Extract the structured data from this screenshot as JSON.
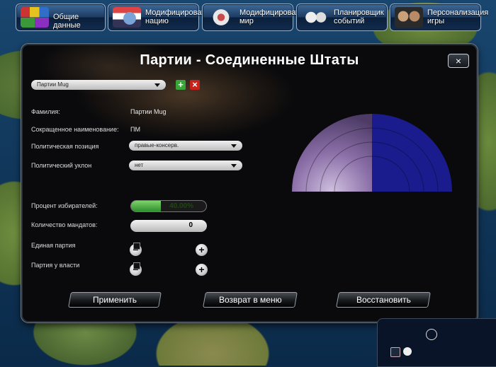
{
  "tabs": [
    {
      "label": "Общие данные",
      "icon": "bricks-icon"
    },
    {
      "label": "Модифицировать нацию",
      "icon": "flag-globe-icon"
    },
    {
      "label": "Модифицировать мир",
      "icon": "world-tools-icon"
    },
    {
      "label": "Планировщик событий",
      "icon": "events-icon"
    },
    {
      "label": "Персонализация игры",
      "icon": "leaders-icon"
    }
  ],
  "dialog": {
    "title": "Партии  -  Соединенные Штаты",
    "close_label": "×",
    "party_select": "Партии Mug",
    "add_label": "+",
    "delete_label": "×",
    "fields": {
      "family_label": "Фамилия:",
      "family_value": "Партии Mug",
      "short_label": "Сокращенное наименование:",
      "short_value": "ПМ",
      "position_label": "Политическая позиция",
      "position_value": "правые-консерв.",
      "bias_label": "Политический уклон",
      "bias_value": "нет",
      "voters_label": "Процент избирателей:",
      "voters_value": "40.00%",
      "voters_fraction": 0.4,
      "seats_label": "Количество мандатов:",
      "seats_value": "0",
      "single_label": "Единая партия",
      "single_checked": false,
      "ruling_label": "Партия у власти",
      "ruling_checked": false
    },
    "buttons": {
      "apply": "Применить",
      "back": "Возврат в меню",
      "restore": "Восстановить"
    }
  },
  "colors": {
    "accent_green": "#3aa33a",
    "delete_red": "#c8201b",
    "seat_blue": "#1a1c8e"
  }
}
